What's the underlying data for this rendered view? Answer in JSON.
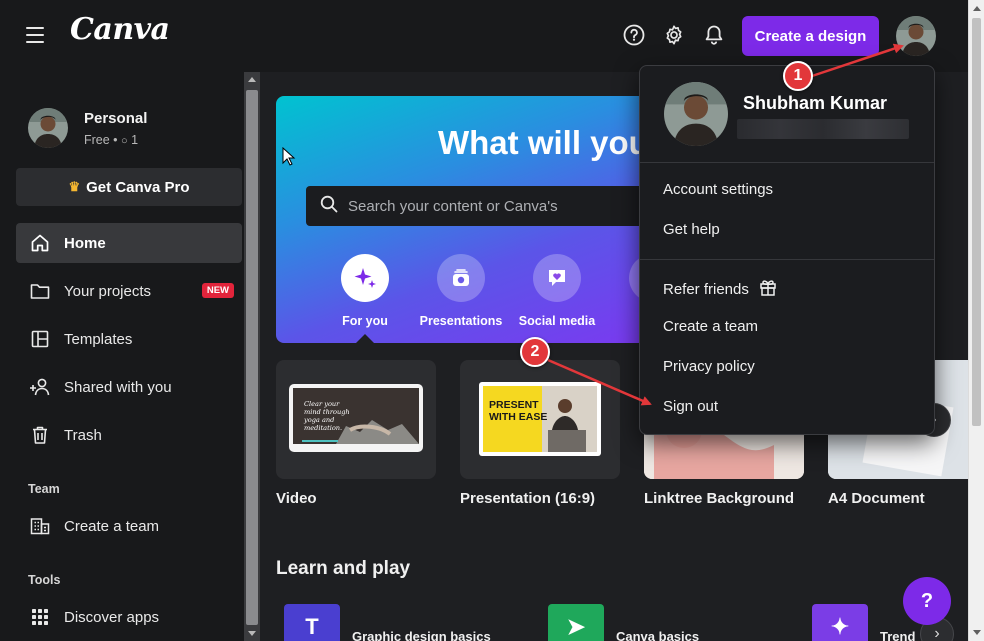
{
  "topbar": {
    "logo": "Canva",
    "create_button": "Create a design",
    "icons": [
      "menu-icon",
      "help-circle-icon",
      "gear-icon",
      "bell-icon"
    ]
  },
  "sidebar": {
    "profile": {
      "name": "Personal",
      "plan": "Free • ",
      "members": "1"
    },
    "pro_button": "Get Canva Pro",
    "nav": [
      {
        "label": "Home",
        "icon": "home-icon",
        "active": true
      },
      {
        "label": "Your projects",
        "icon": "folder-icon",
        "badge": "NEW"
      },
      {
        "label": "Templates",
        "icon": "templates-icon"
      },
      {
        "label": "Shared with you",
        "icon": "shared-users-icon"
      },
      {
        "label": "Trash",
        "icon": "trash-icon"
      }
    ],
    "team_section": {
      "label": "Team",
      "item": "Create a team"
    },
    "tools_section": {
      "label": "Tools",
      "item": "Discover apps"
    }
  },
  "hero": {
    "title": "What will you",
    "search_placeholder": "Search your content or Canva's",
    "categories": [
      {
        "label": "For you",
        "icon": "sparkle-icon"
      },
      {
        "label": "Presentations",
        "icon": "presentation-icon"
      },
      {
        "label": "Social media",
        "icon": "heart-chat-icon"
      }
    ]
  },
  "designs": [
    {
      "label": "Video",
      "thumb_text": "Clear your mind through yoga and meditation."
    },
    {
      "label": "Presentation (16:9)",
      "thumb_text": "PRESENT WITH EASE"
    },
    {
      "label": "Linktree Background"
    },
    {
      "label": "A4 Document"
    }
  ],
  "learn": {
    "title": "Learn and play",
    "items": [
      "Graphic design basics",
      "Canva basics",
      "Trend"
    ]
  },
  "dropdown": {
    "name": "Shubham Kumar",
    "items_group1": [
      "Account settings",
      "Get help"
    ],
    "items_group2": [
      "Refer friends",
      "Create a team",
      "Privacy policy",
      "Sign out"
    ]
  },
  "annotations": {
    "marker1": "1",
    "marker2": "2",
    "accent": "#e2373a"
  },
  "help_fab": "?",
  "colors": {
    "brand": "#7d2ae8",
    "new_badge": "#e2243b",
    "crown": "#f5b731"
  }
}
